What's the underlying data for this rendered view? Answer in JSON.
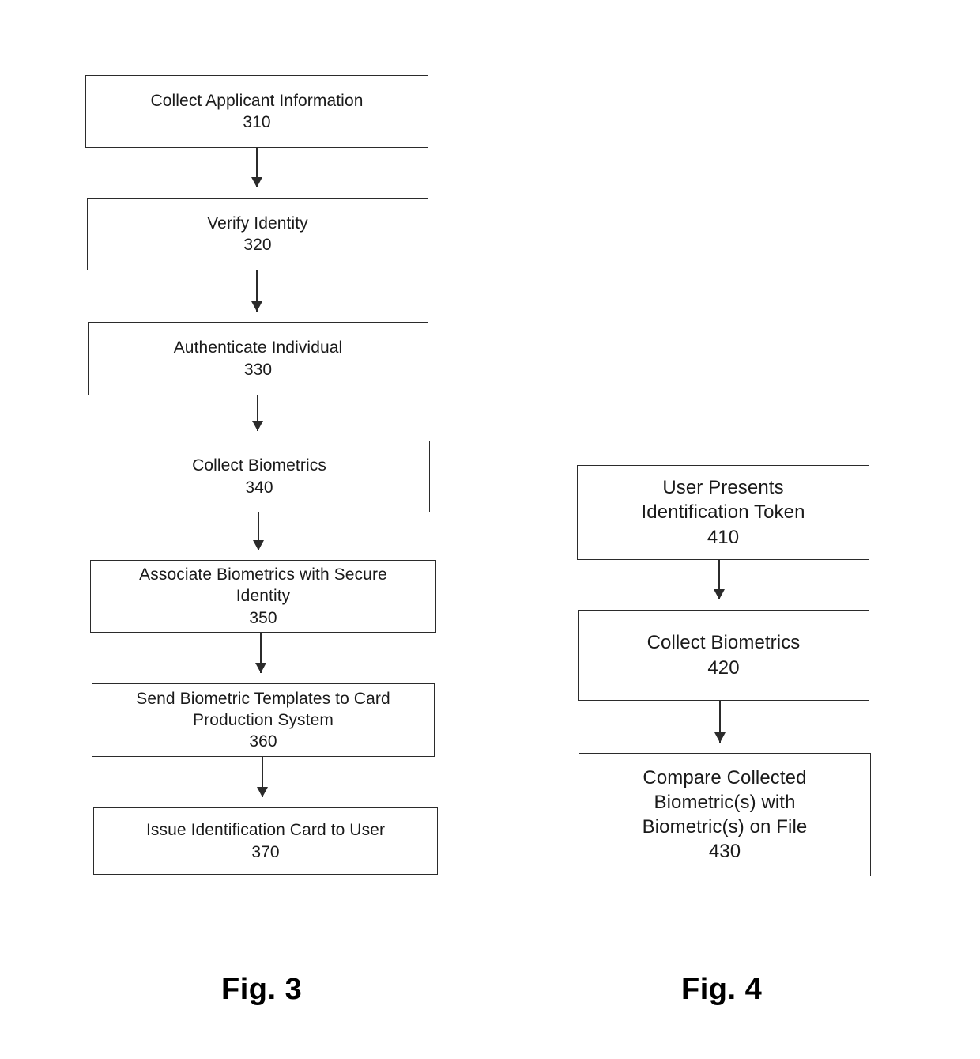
{
  "document": {
    "type": "patent-drawing-sheet",
    "figures": [
      {
        "id": "fig3",
        "caption": "Fig. 3",
        "nodes": [
          {
            "label": "Collect Applicant Information",
            "ref": "310"
          },
          {
            "label": "Verify Identity",
            "ref": "320"
          },
          {
            "label": "Authenticate Individual",
            "ref": "330"
          },
          {
            "label": "Collect Biometrics",
            "ref": "340"
          },
          {
            "label": "Associate Biometrics with Secure\nIdentity",
            "ref": "350"
          },
          {
            "label": "Send Biometric Templates to Card\nProduction System",
            "ref": "360"
          },
          {
            "label": "Issue Identification Card to User",
            "ref": "370"
          }
        ]
      },
      {
        "id": "fig4",
        "caption": "Fig. 4",
        "nodes": [
          {
            "label": "User Presents\nIdentification Token",
            "ref": "410"
          },
          {
            "label": "Collect Biometrics",
            "ref": "420"
          },
          {
            "label": "Compare Collected\nBiometric(s) with\nBiometric(s) on File",
            "ref": "430"
          }
        ]
      }
    ]
  },
  "style": {
    "stroke_color": "#2b2b2b",
    "text_color": "#1a1a1a",
    "background_color": "#ffffff"
  }
}
